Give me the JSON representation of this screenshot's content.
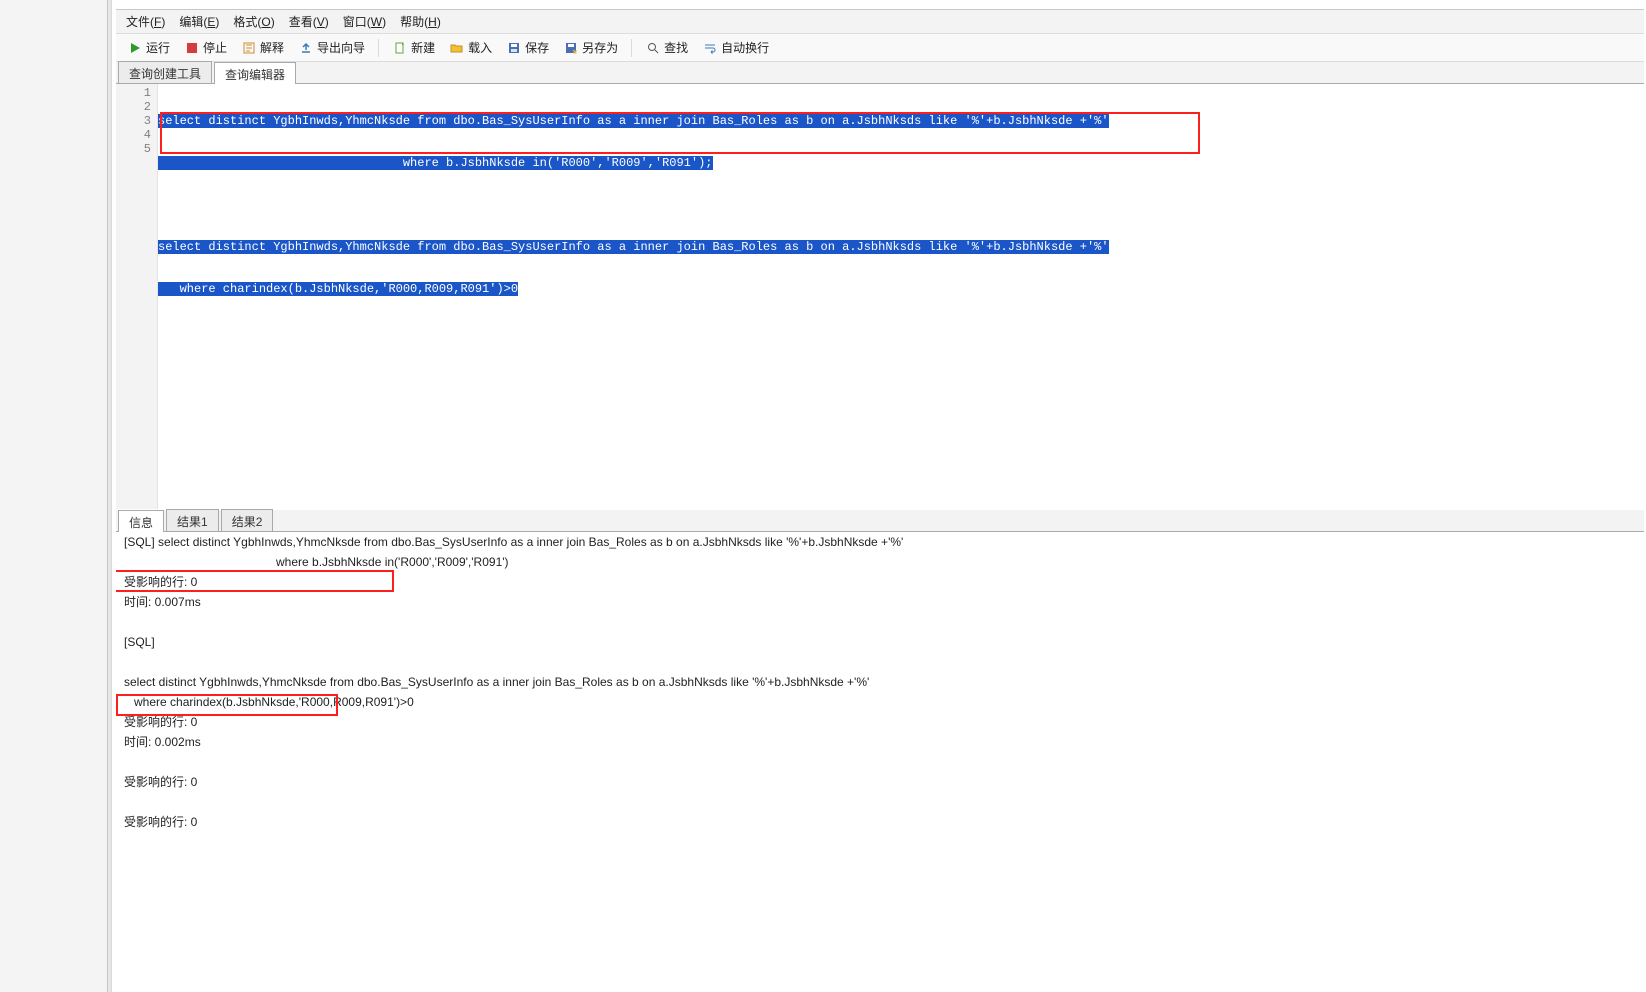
{
  "menubar": {
    "file": {
      "label": "文件",
      "mn": "F"
    },
    "edit": {
      "label": "编辑",
      "mn": "E"
    },
    "format": {
      "label": "格式",
      "mn": "O"
    },
    "view": {
      "label": "查看",
      "mn": "V"
    },
    "window": {
      "label": "窗口",
      "mn": "W"
    },
    "help": {
      "label": "帮助",
      "mn": "H"
    }
  },
  "toolbar": {
    "run": "运行",
    "stop": "停止",
    "explain": "解释",
    "export_wizard": "导出向导",
    "new": "新建",
    "load": "载入",
    "save": "保存",
    "save_as": "另存为",
    "find": "查找",
    "auto_wrap": "自动换行"
  },
  "editor_tabs": {
    "builder": "查询创建工具",
    "editor": "查询编辑器"
  },
  "code_lines": {
    "l1": "select distinct YgbhInwds,YhmcNksde from dbo.Bas_SysUserInfo as a inner join Bas_Roles as b on a.JsbhNksds like '%'+b.JsbhNksde +'%'",
    "l2": "                                  where b.JsbhNksde in('R000','R009','R091');",
    "l3": "",
    "l4": "select distinct YgbhInwds,YhmcNksde from dbo.Bas_SysUserInfo as a inner join Bas_Roles as b on a.JsbhNksds like '%'+b.JsbhNksde +'%'",
    "l5": "   where charindex(b.JsbhNksde,'R000,R009,R091')>0"
  },
  "line_numbers": {
    "l1": "1",
    "l2": "2",
    "l3": "3",
    "l4": "4",
    "l5": "5"
  },
  "result_tabs": {
    "info": "信息",
    "r1": "结果1",
    "r2": "结果2"
  },
  "messages": {
    "m1": "[SQL] select distinct YgbhInwds,YhmcNksde from dbo.Bas_SysUserInfo as a inner join Bas_Roles as b on a.JsbhNksds like '%'+b.JsbhNksde +'%'",
    "m1b": "where b.JsbhNksde in('R000','R009','R091')",
    "m2": "受影响的行: 0",
    "m3": "时间: 0.007ms",
    "m4": "[SQL]",
    "m5": "select distinct YgbhInwds,YhmcNksde from dbo.Bas_SysUserInfo as a inner join Bas_Roles as b on a.JsbhNksds like '%'+b.JsbhNksde +'%'",
    "m5b": "   where charindex(b.JsbhNksde,'R000,R009,R091')>0",
    "m6": "受影响的行: 0",
    "m7": "时间: 0.002ms",
    "m8": "受影响的行: 0",
    "m9": "受影响的行: 0"
  }
}
